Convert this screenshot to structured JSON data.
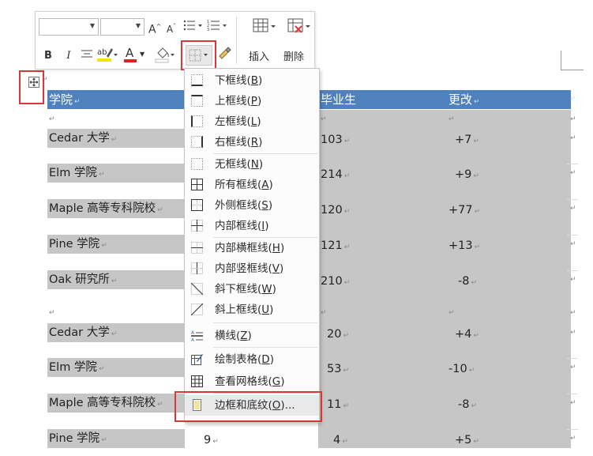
{
  "toolbar": {
    "bold": "B",
    "italic": "I",
    "grow_font": "A",
    "shrink_font": "A",
    "font_color_letter": "A",
    "insert_label": "插入",
    "delete_label": "删除"
  },
  "table": {
    "headers": [
      "学院",
      "毕业生",
      "更改"
    ],
    "rows": [
      {
        "name": "Cedar 大学",
        "grads": "103",
        "change": "+7"
      },
      {
        "name": "Elm 学院",
        "grads": "214",
        "change": "+9"
      },
      {
        "name": "Maple 高等专科院校",
        "grads": "120",
        "change": "+77"
      },
      {
        "name": "Pine 学院",
        "grads": "121",
        "change": "+13"
      },
      {
        "name": "Oak 研究所",
        "grads": "210",
        "change": "-8"
      },
      {
        "name": "Cedar 大学",
        "grads": "20",
        "change": "+4"
      },
      {
        "name": "Elm 学院",
        "grads": "53",
        "change": "-10"
      },
      {
        "name": "Maple 高等专科院校",
        "grads": "11",
        "change": "-8"
      },
      {
        "name": "Pine 学院",
        "grads": "4",
        "change": "+5",
        "extra": "9"
      }
    ]
  },
  "border_menu": {
    "items": [
      {
        "label": "下框线(",
        "key": "B",
        "tail": ")",
        "icon": "bottom-border-icon"
      },
      {
        "label": "上框线(",
        "key": "P",
        "tail": ")",
        "icon": "top-border-icon"
      },
      {
        "label": "左框线(",
        "key": "L",
        "tail": ")",
        "icon": "left-border-icon"
      },
      {
        "label": "右框线(",
        "key": "R",
        "tail": ")",
        "icon": "right-border-icon"
      },
      {
        "label": "无框线(",
        "key": "N",
        "tail": ")",
        "icon": "no-border-icon"
      },
      {
        "label": "所有框线(",
        "key": "A",
        "tail": ")",
        "icon": "all-borders-icon"
      },
      {
        "label": "外侧框线(",
        "key": "S",
        "tail": ")",
        "icon": "outside-borders-icon"
      },
      {
        "label": "内部框线(",
        "key": "I",
        "tail": ")",
        "icon": "inside-borders-icon"
      },
      {
        "label": "内部横框线(",
        "key": "H",
        "tail": ")",
        "icon": "inside-horizontal-border-icon"
      },
      {
        "label": "内部竖框线(",
        "key": "V",
        "tail": ")",
        "icon": "inside-vertical-border-icon"
      },
      {
        "label": "斜下框线(",
        "key": "W",
        "tail": ")",
        "icon": "diagonal-down-border-icon"
      },
      {
        "label": "斜上框线(",
        "key": "U",
        "tail": ")",
        "icon": "diagonal-up-border-icon"
      },
      {
        "label": "横线(",
        "key": "Z",
        "tail": ")",
        "icon": "horizontal-line-icon"
      },
      {
        "label": "绘制表格(",
        "key": "D",
        "tail": ")",
        "icon": "draw-table-icon"
      },
      {
        "label": "查看网格线(",
        "key": "G",
        "tail": ")",
        "icon": "view-gridlines-icon"
      },
      {
        "label": "边框和底纹(",
        "key": "O",
        "tail": ")...",
        "icon": "borders-and-shading-icon"
      }
    ]
  },
  "colors": {
    "header_fill": "#4f81bd",
    "row_shading": "#c6c6c6",
    "highlight_border": "#d9383a",
    "font_color_bar": "#e0201b",
    "highlight_bar": "#f5e400"
  }
}
